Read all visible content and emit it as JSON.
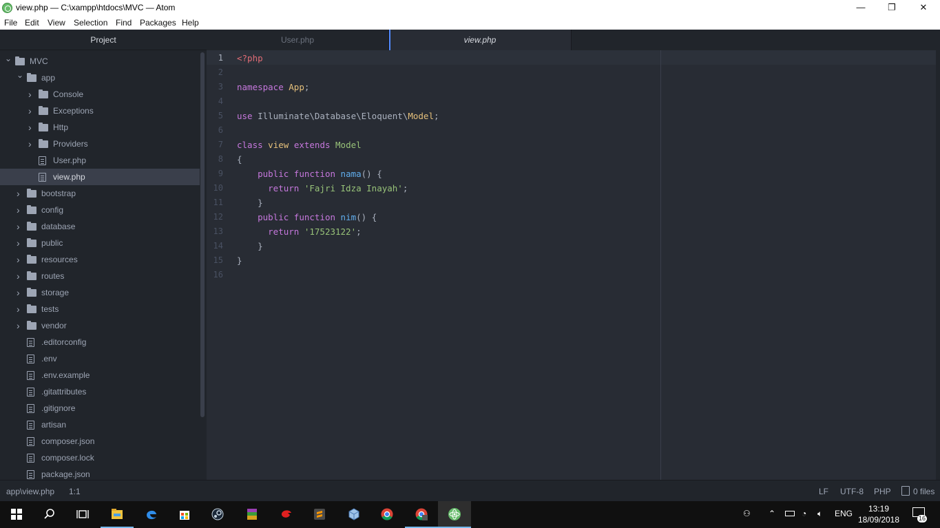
{
  "window": {
    "title": "view.php — C:\\xampp\\htdocs\\MVC — Atom",
    "minimize": "—",
    "maximize": "❐",
    "close": "✕"
  },
  "menu": [
    "File",
    "Edit",
    "View",
    "Selection",
    "Find",
    "Packages",
    "Help"
  ],
  "sidebar": {
    "header": "Project",
    "tree": [
      {
        "label": "MVC",
        "kind": "folder",
        "expanded": true
      },
      {
        "label": "app",
        "kind": "folder",
        "expanded": true
      },
      {
        "label": "Console",
        "kind": "folder",
        "expanded": false
      },
      {
        "label": "Exceptions",
        "kind": "folder",
        "expanded": false
      },
      {
        "label": "Http",
        "kind": "folder",
        "expanded": false
      },
      {
        "label": "Providers",
        "kind": "folder",
        "expanded": false
      },
      {
        "label": "User.php",
        "kind": "file"
      },
      {
        "label": "view.php",
        "kind": "file",
        "selected": true
      },
      {
        "label": "bootstrap",
        "kind": "folder",
        "expanded": false
      },
      {
        "label": "config",
        "kind": "folder",
        "expanded": false
      },
      {
        "label": "database",
        "kind": "folder",
        "expanded": false
      },
      {
        "label": "public",
        "kind": "folder",
        "expanded": false
      },
      {
        "label": "resources",
        "kind": "folder",
        "expanded": false
      },
      {
        "label": "routes",
        "kind": "folder",
        "expanded": false
      },
      {
        "label": "storage",
        "kind": "folder",
        "expanded": false
      },
      {
        "label": "tests",
        "kind": "folder",
        "expanded": false
      },
      {
        "label": "vendor",
        "kind": "folder",
        "expanded": false
      },
      {
        "label": ".editorconfig",
        "kind": "file"
      },
      {
        "label": ".env",
        "kind": "file"
      },
      {
        "label": ".env.example",
        "kind": "file"
      },
      {
        "label": ".gitattributes",
        "kind": "file"
      },
      {
        "label": ".gitignore",
        "kind": "file"
      },
      {
        "label": "artisan",
        "kind": "file"
      },
      {
        "label": "composer.json",
        "kind": "file"
      },
      {
        "label": "composer.lock",
        "kind": "file"
      },
      {
        "label": "package.json",
        "kind": "file"
      }
    ]
  },
  "tabs": [
    {
      "label": "User.php",
      "active": false
    },
    {
      "label": "view.php",
      "active": true
    }
  ],
  "editor": {
    "current_line": 1,
    "lines": [
      [
        [
          "tk-punct",
          "<?php"
        ]
      ],
      [],
      [
        [
          "tk-kw",
          "namespace"
        ],
        [
          "tk-txt",
          " "
        ],
        [
          "tk-type",
          "App"
        ],
        [
          "tk-txt",
          ";"
        ]
      ],
      [],
      [
        [
          "tk-kw",
          "use"
        ],
        [
          "tk-txt",
          " Illuminate\\Database\\Eloquent\\"
        ],
        [
          "tk-type",
          "Model"
        ],
        [
          "tk-txt",
          ";"
        ]
      ],
      [],
      [
        [
          "tk-kw",
          "class"
        ],
        [
          "tk-txt",
          " "
        ],
        [
          "tk-type",
          "view"
        ],
        [
          "tk-txt",
          " "
        ],
        [
          "tk-kw",
          "extends"
        ],
        [
          "tk-txt",
          " "
        ],
        [
          "tk-str",
          "Model"
        ]
      ],
      [
        [
          "tk-txt",
          "{"
        ]
      ],
      [
        [
          "tk-txt",
          "    "
        ],
        [
          "tk-kw",
          "public"
        ],
        [
          "tk-txt",
          " "
        ],
        [
          "tk-kw",
          "function"
        ],
        [
          "tk-txt",
          " "
        ],
        [
          "tk-fn",
          "nama"
        ],
        [
          "tk-txt",
          "() {"
        ]
      ],
      [
        [
          "tk-txt",
          "      "
        ],
        [
          "tk-kw",
          "return"
        ],
        [
          "tk-txt",
          " "
        ],
        [
          "tk-str",
          "'Fajri Idza Inayah'"
        ],
        [
          "tk-txt",
          ";"
        ]
      ],
      [
        [
          "tk-txt",
          "    }"
        ]
      ],
      [
        [
          "tk-txt",
          "    "
        ],
        [
          "tk-kw",
          "public"
        ],
        [
          "tk-txt",
          " "
        ],
        [
          "tk-kw",
          "function"
        ],
        [
          "tk-txt",
          " "
        ],
        [
          "tk-fn",
          "nim"
        ],
        [
          "tk-txt",
          "() {"
        ]
      ],
      [
        [
          "tk-txt",
          "      "
        ],
        [
          "tk-kw",
          "return"
        ],
        [
          "tk-txt",
          " "
        ],
        [
          "tk-str",
          "'17523122'"
        ],
        [
          "tk-txt",
          ";"
        ]
      ],
      [
        [
          "tk-txt",
          "    }"
        ]
      ],
      [
        [
          "tk-txt",
          "}"
        ]
      ],
      []
    ]
  },
  "status": {
    "file_path": "app\\view.php",
    "cursor_pos": "1:1",
    "line_ending": "LF",
    "encoding": "UTF-8",
    "grammar": "PHP",
    "git_files": "0 files"
  },
  "taskbar": {
    "apps": [
      "start-icon",
      "search-icon",
      "task-view-icon",
      "file-explorer-icon",
      "edge-icon",
      "store-icon",
      "steam-icon",
      "winrar-icon",
      "garena-icon",
      "sublime-text-icon",
      "virtualbox-icon",
      "chrome-icon",
      "chrome-profile-icon",
      "atom-icon"
    ],
    "language": "ENG",
    "time": "13:19",
    "date": "18/09/2018",
    "notifications": "16"
  }
}
